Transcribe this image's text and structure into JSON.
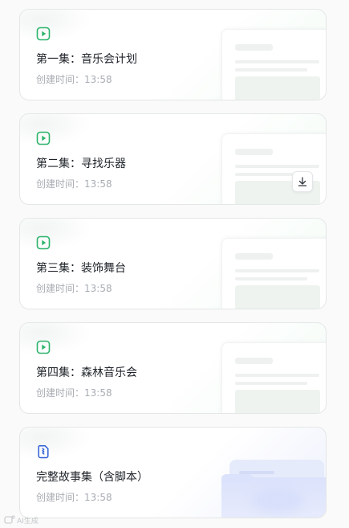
{
  "episodes": [
    {
      "title": "第一集：音乐会计划",
      "time": "创建时间：13:58",
      "icon": "play-icon"
    },
    {
      "title": "第二集：寻找乐器",
      "time": "创建时间：13:58",
      "icon": "play-icon"
    },
    {
      "title": "第三集：装饰舞台",
      "time": "创建时间：13:58",
      "icon": "play-icon"
    },
    {
      "title": "第四集：森林音乐会",
      "time": "创建时间：13:58",
      "icon": "play-icon"
    }
  ],
  "story_collection": {
    "title": "完整故事集（含脚本）",
    "time": "创建时间：13:58",
    "icon": "document-icon"
  },
  "download_button": {
    "icon": "download-icon"
  },
  "watermark": {
    "text": "AI生成",
    "icon": "ai-watermark-icon"
  },
  "colors": {
    "episode_icon": "#2db46c",
    "story_icon": "#2f5fd7",
    "title_text": "#1f2329",
    "meta_text": "#a9adb3"
  }
}
